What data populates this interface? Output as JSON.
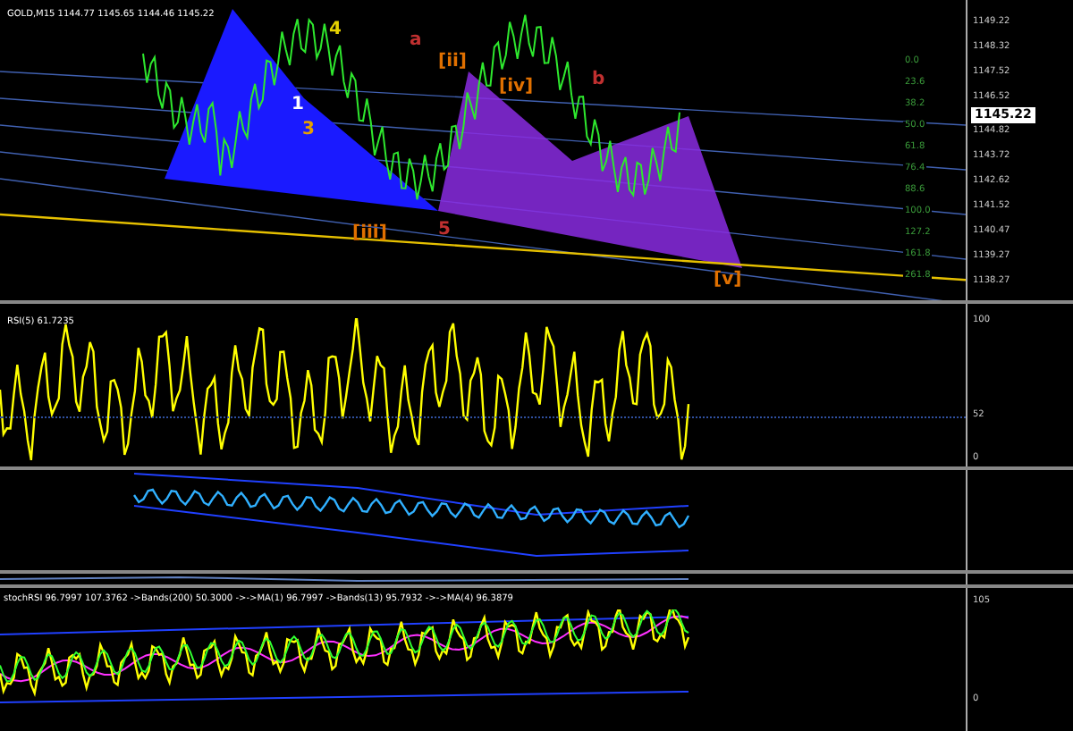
{
  "main_chart": {
    "header": "GOLD,M15  1144.77 1145.65 1144.46 1145.22",
    "current_price": "1145.22",
    "price_axis": [
      "1149.22",
      "1148.32",
      "1147.52",
      "1146.52",
      "1144.82",
      "1143.72",
      "1142.62",
      "1141.52",
      "1140.47",
      "1139.27",
      "1138.27"
    ],
    "fib_levels": [
      "0.0",
      "23.6",
      "38.2",
      "50.0",
      "61.8",
      "76.4",
      "88.6",
      "100.0",
      "127.2",
      "161.8",
      "261.8"
    ],
    "wave_labels": [
      {
        "text": "4",
        "color": "#e6d200"
      },
      {
        "text": "1",
        "color": "#ffffff"
      },
      {
        "text": "3",
        "color": "#e6a000"
      },
      {
        "text": "a",
        "color": "#c03030"
      },
      {
        "text": "[ii]",
        "color": "#e07000"
      },
      {
        "text": "[iv]",
        "color": "#e07000"
      },
      {
        "text": "[iii]",
        "color": "#e07000"
      },
      {
        "text": "5",
        "color": "#c03030"
      },
      {
        "text": "b",
        "color": "#c03030"
      },
      {
        "text": "[v]",
        "color": "#e07000"
      }
    ]
  },
  "rsi_pane": {
    "label": "RSI(5) 61.7235",
    "axis": [
      "100",
      "52",
      "0"
    ]
  },
  "stoch_pane": {
    "label": "stochRSI 96.7997 107.3762 ->Bands(200) 50.3000 ->->MA(1) 96.7997 ->Bands(13) 95.7932 ->->MA(4) 96.3879",
    "axis": [
      "105",
      "0"
    ]
  }
}
